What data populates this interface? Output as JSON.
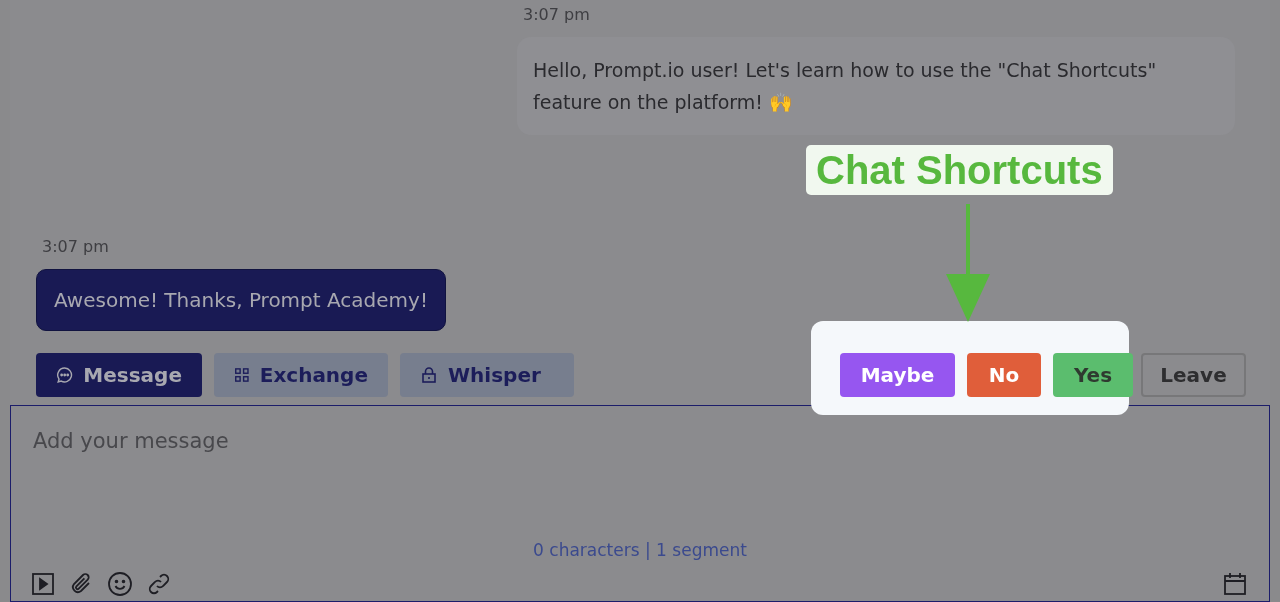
{
  "messages": [
    {
      "kind": "outgoing",
      "time": "3:07 pm",
      "text": "Hello, Prompt.io user! Let's learn how to use the \"Chat Shortcuts\" feature on the platform! 🙌"
    },
    {
      "kind": "incoming",
      "time": "3:07 pm",
      "text": "Awesome! Thanks, Prompt Academy!"
    }
  ],
  "modes": [
    {
      "label": "Message",
      "selected": true
    },
    {
      "label": "Exchange",
      "selected": false
    },
    {
      "label": "Whisper",
      "selected": false
    }
  ],
  "shortcuts": [
    {
      "label": "Maybe",
      "color": "#9656f0"
    },
    {
      "label": "No",
      "color": "#e05e3a"
    },
    {
      "label": "Yes",
      "color": "#5bbd6e"
    }
  ],
  "leave_button": "Leave",
  "composer": {
    "placeholder": "Add your message",
    "counter": "0 characters | 1 segment"
  },
  "callout": {
    "title": "Chat Shortcuts"
  }
}
